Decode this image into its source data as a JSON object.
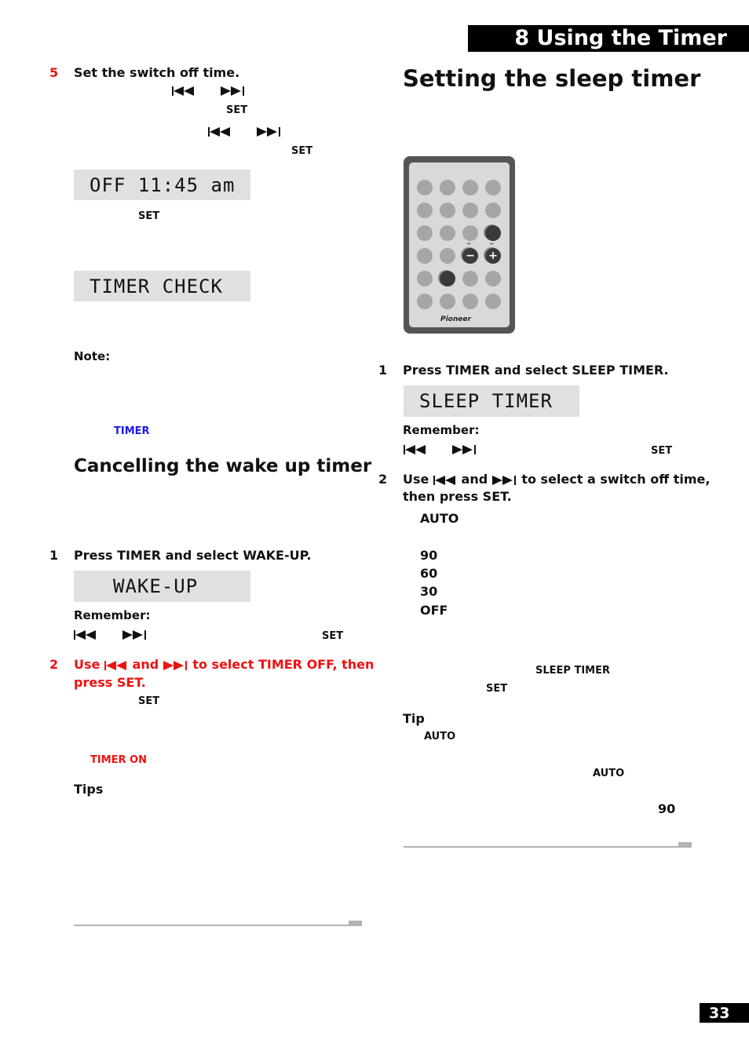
{
  "header": {
    "chapter_title": "8  Using the Timer",
    "page_number": "33"
  },
  "left": {
    "step5": {
      "number": "5",
      "text": "Set the switch off time.",
      "set_label_1": "SET",
      "set_label_2": "SET"
    },
    "lcd_off_time": "OFF 11:45 am",
    "set_label_3": "SET",
    "lcd_timer_check": "TIMER CHECK",
    "note_label": "Note:",
    "timer_blue": "TIMER",
    "section_title": "Cancelling the wake up timer",
    "step1": {
      "number": "1",
      "text": "Press TIMER and select WAKE-UP."
    },
    "lcd_wake_up": "WAKE-UP",
    "remember_label": "Remember:",
    "remember_set": "SET",
    "step2": {
      "number": "2",
      "text_use": "Use",
      "text_and": "and",
      "text_rest": "to select TIMER OFF, then",
      "text_line2": "press SET."
    },
    "set_label_4": "SET",
    "timer_on_red": "TIMER ON",
    "tips_label": "Tips"
  },
  "right": {
    "section_title": "Setting the sleep timer",
    "remote": {
      "brand": "Pioneer",
      "minus_symbol": "−",
      "plus_symbol": "+",
      "prev_label": "⏮",
      "next_label": "⏭"
    },
    "step1": {
      "number": "1",
      "text": "Press TIMER and select SLEEP TIMER."
    },
    "lcd_sleep_timer": "SLEEP TIMER",
    "remember_label": "Remember:",
    "remember_set": "SET",
    "step2": {
      "number": "2",
      "text_use": "Use",
      "text_and": "and",
      "text_rest": "to select a switch off time,",
      "text_line2": "then press SET."
    },
    "options": [
      "AUTO",
      "90",
      "60",
      "30",
      "OFF"
    ],
    "sleep_timer_label": "SLEEP TIMER",
    "set_label": "SET",
    "tip_label": "Tip",
    "tip_auto_1": "AUTO",
    "tip_auto_2": "AUTO",
    "tip_90": "90"
  },
  "icons": {
    "rewind": "skip-back-icon",
    "forward": "skip-forward-icon"
  }
}
